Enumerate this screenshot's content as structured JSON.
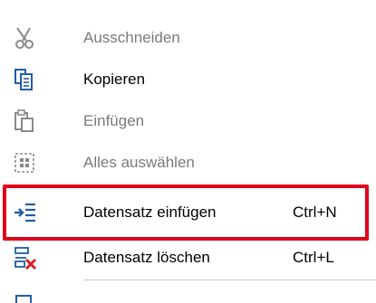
{
  "menu": {
    "items": [
      {
        "label": "Ausschneiden",
        "shortcut": "",
        "icon": "scissors-icon",
        "enabled": false
      },
      {
        "label": "Kopieren",
        "shortcut": "",
        "icon": "copy-icon",
        "enabled": true
      },
      {
        "label": "Einfügen",
        "shortcut": "",
        "icon": "paste-icon",
        "enabled": false
      },
      {
        "label": "Alles auswählen",
        "shortcut": "",
        "icon": "select-all-icon",
        "enabled": false
      },
      {
        "label": "Datensatz einfügen",
        "shortcut": "Ctrl+N",
        "icon": "insert-record-icon",
        "enabled": true
      },
      {
        "label": "Datensatz löschen",
        "shortcut": "Ctrl+L",
        "icon": "delete-record-icon",
        "enabled": true
      }
    ],
    "highlight_color": "#e0001a",
    "icon_color": "#1f5ea8",
    "delete_icon_color": "#d0202a"
  }
}
